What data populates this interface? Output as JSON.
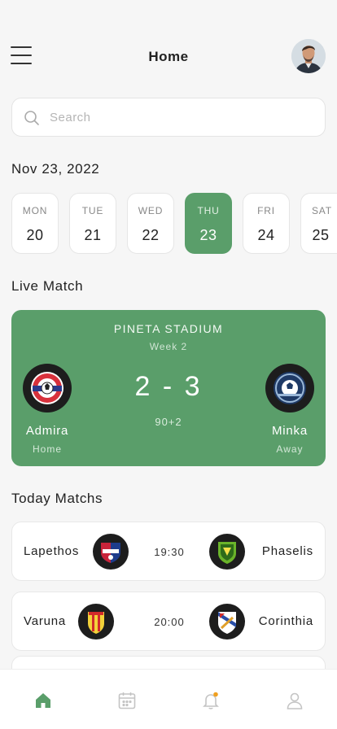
{
  "header": {
    "title": "Home"
  },
  "search": {
    "placeholder": "Search"
  },
  "date_heading": "Nov 23, 2022",
  "days": [
    {
      "dow": "MON",
      "num": "20",
      "active": false
    },
    {
      "dow": "TUE",
      "num": "21",
      "active": false
    },
    {
      "dow": "WED",
      "num": "22",
      "active": false
    },
    {
      "dow": "THU",
      "num": "23",
      "active": true
    },
    {
      "dow": "FRI",
      "num": "24",
      "active": false
    },
    {
      "dow": "SAT",
      "num": "25",
      "active": false
    }
  ],
  "live": {
    "section_title": "Live Match",
    "stadium": "PINETA STADIUM",
    "week": "Week 2",
    "score": "2 - 3",
    "minute": "90+2",
    "home": {
      "name": "Admira",
      "side": "Home"
    },
    "away": {
      "name": "Minka",
      "side": "Away"
    }
  },
  "today": {
    "section_title": "Today Matchs",
    "matches": [
      {
        "home": "Lapethos",
        "time": "19:30",
        "away": "Phaselis"
      },
      {
        "home": "Varuna",
        "time": "20:00",
        "away": "Corinthia"
      }
    ]
  },
  "nav": {
    "active_color": "#5a9e6a",
    "inactive_color": "#c4c4c4",
    "badge_color": "#f0a020",
    "items": [
      "home-icon",
      "calendar-icon",
      "bell-icon",
      "user-icon"
    ]
  },
  "colors": {
    "accent": "#5a9e6a"
  }
}
